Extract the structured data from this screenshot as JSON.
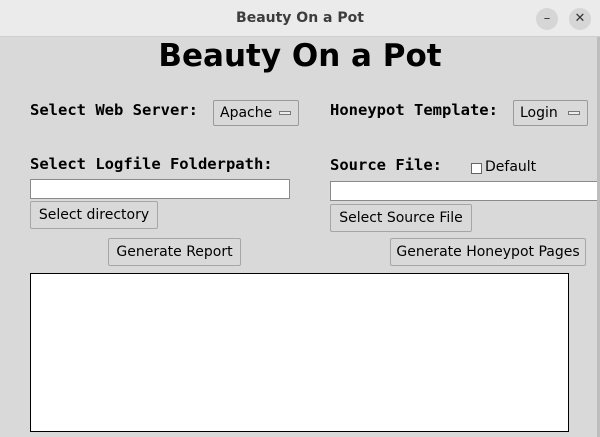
{
  "window": {
    "title": "Beauty On a Pot",
    "minimize_symbol": "–",
    "close_symbol": "✕"
  },
  "app_title": "Beauty On a Pot",
  "web_server": {
    "label": "Select Web Server:",
    "selected": "Apache"
  },
  "honeypot_template": {
    "label": "Honeypot Template:",
    "selected": "Login"
  },
  "logfile": {
    "label": "Select Logfile Folderpath:",
    "value": "",
    "button": "Select directory"
  },
  "source_file": {
    "label": "Source File:",
    "checkbox_label": "Default",
    "checkbox_checked": false,
    "value": "",
    "button": "Select Source File"
  },
  "actions": {
    "generate_report": "Generate Report",
    "generate_honeypot": "Generate Honeypot Pages"
  },
  "output_text": ""
}
